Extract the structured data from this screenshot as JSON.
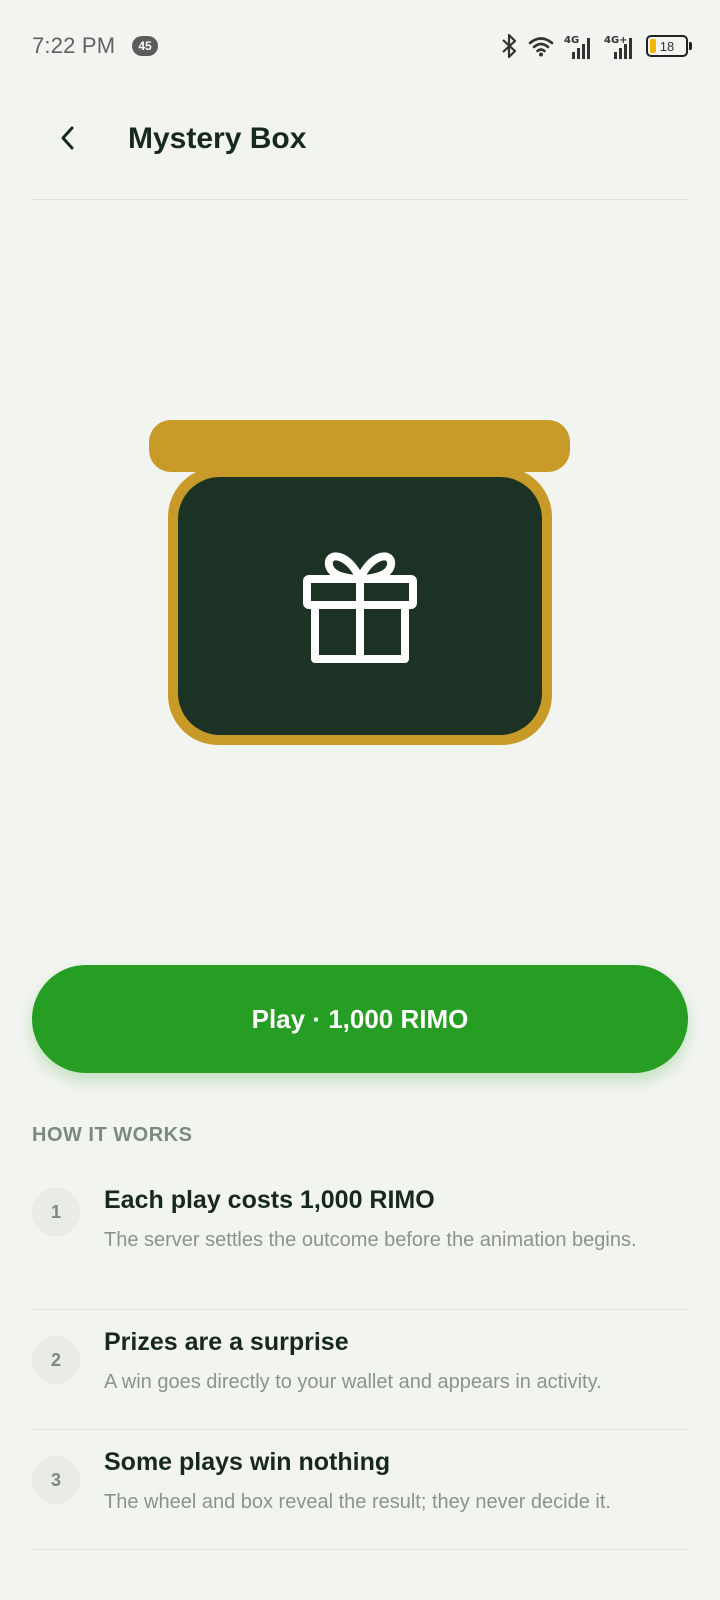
{
  "status_bar": {
    "time": "7:22 PM",
    "notification_count": "45",
    "network_1": "4G",
    "network_2": "4G+",
    "battery_level": "18",
    "icons": [
      "bluetooth-icon",
      "wifi-icon",
      "signal-icon",
      "signal-icon",
      "battery-icon"
    ]
  },
  "header": {
    "title": "Mystery Box",
    "back_icon": "chevron-left-icon"
  },
  "hero": {
    "icon": "gift-icon"
  },
  "play_button": {
    "label": "Play · 1,000 RIMO"
  },
  "how_it_works": {
    "title": "HOW IT WORKS",
    "steps": [
      {
        "number": "1",
        "title": "Each play costs 1,000 RIMO",
        "description": "The server settles the outcome before the animation begins."
      },
      {
        "number": "2",
        "title": "Prizes are a surprise",
        "description": "A win goes directly to your wallet and appears in activity."
      },
      {
        "number": "3",
        "title": "Some plays win nothing",
        "description": "The wheel and box reveal the result; they never decide it."
      }
    ]
  },
  "colors": {
    "background": "#f2f4ef",
    "primary_green": "#269e24",
    "box_gold": "#c89a28",
    "box_dark": "#1b3224",
    "text_dark": "#17291f",
    "text_muted": "#8a948d"
  }
}
